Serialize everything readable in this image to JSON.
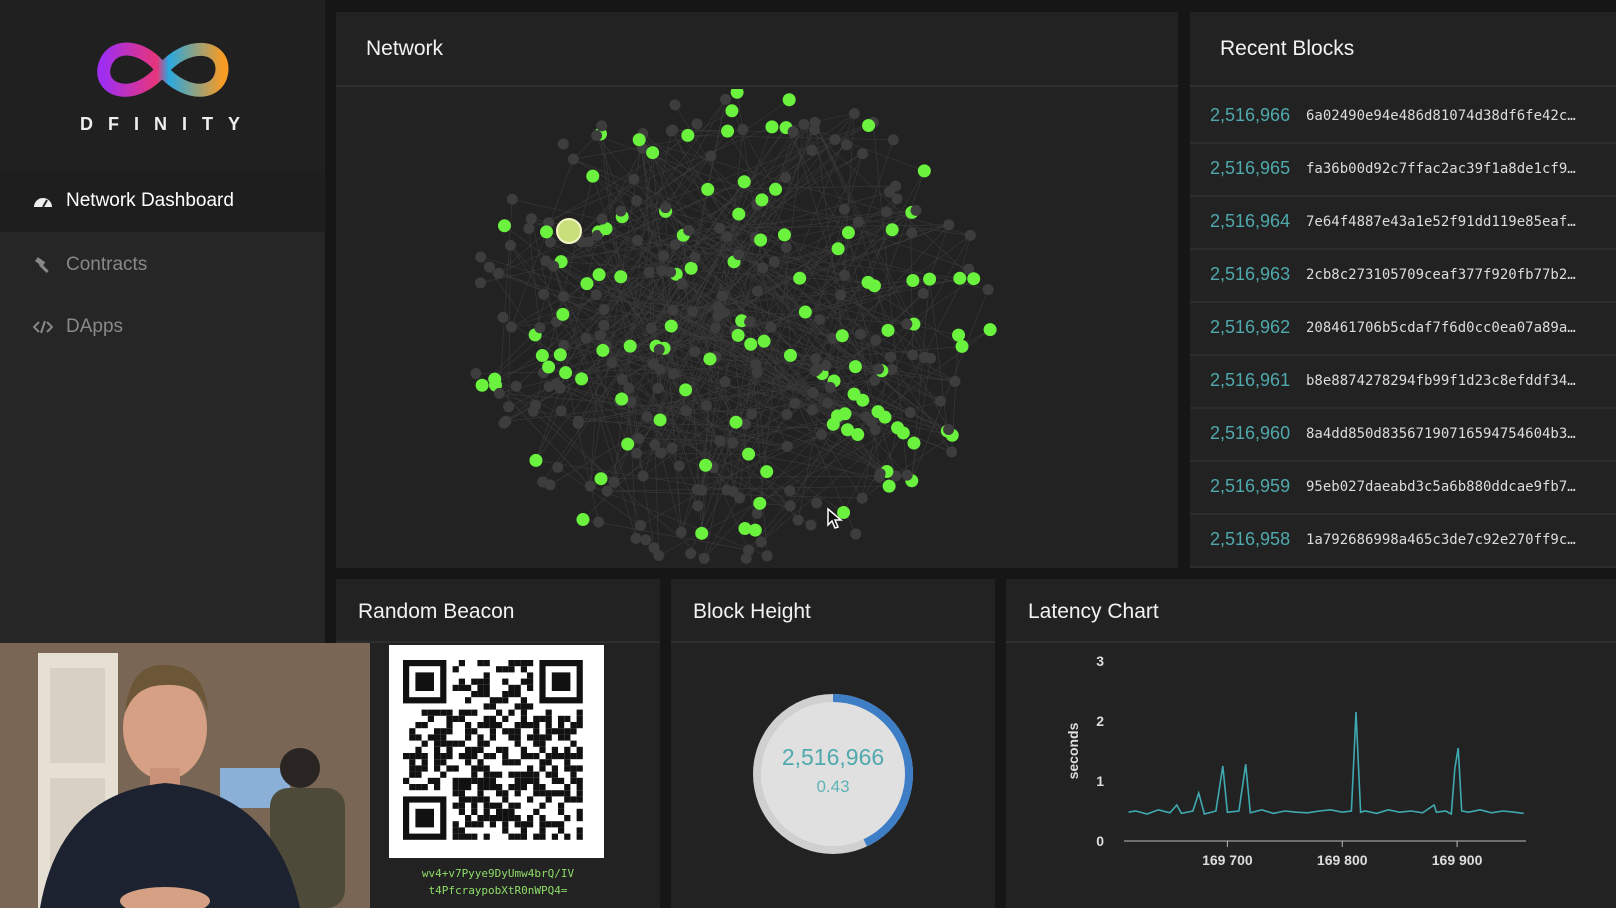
{
  "brand": {
    "logo_text": "DFINITY"
  },
  "sidebar": {
    "items": [
      {
        "label": "Network Dashboard",
        "icon": "dashboard-gauge-icon",
        "active": true
      },
      {
        "label": "Contracts",
        "icon": "hammer-icon",
        "active": false
      },
      {
        "label": "DApps",
        "icon": "code-brackets-icon",
        "active": false
      }
    ]
  },
  "network": {
    "title": "Network",
    "accent": "#6af23f"
  },
  "recent_blocks": {
    "title": "Recent Blocks",
    "rows": [
      {
        "height": "2,516,966",
        "hash": "6a02490e94e486d81074d38df6fe42c…"
      },
      {
        "height": "2,516,965",
        "hash": "fa36b00d92c7ffac2ac39f1a8de1cf9…"
      },
      {
        "height": "2,516,964",
        "hash": "7e64f4887e43a1e52f91dd119e85eaf…"
      },
      {
        "height": "2,516,963",
        "hash": "2cb8c273105709ceaf377f920fb77b2…"
      },
      {
        "height": "2,516,962",
        "hash": "208461706b5cdaf7f6d0cc0ea07a89a…"
      },
      {
        "height": "2,516,961",
        "hash": "b8e8874278294fb99f1d23c8efddf34…"
      },
      {
        "height": "2,516,960",
        "hash": "8a4dd850d83567190716594754604b3…"
      },
      {
        "height": "2,516,959",
        "hash": "95eb027daeabd3c5a6b880ddcae9fb7…"
      },
      {
        "height": "2,516,958",
        "hash": "1a792686998a465c3de7c92e270ff9c…"
      }
    ]
  },
  "random_beacon": {
    "title": "Random Beacon",
    "caption_line1": "wv4+v7Pyye9DyUmw4brQ/IV",
    "caption_line2": "t4PfcraypobXtR0nWPQ4="
  },
  "block_height": {
    "title": "Block Height",
    "value": "2,516,966",
    "sub_value": "0.43",
    "ring_progress": 0.43,
    "accent": "#4fa9ad"
  },
  "latency_chart": {
    "title": "Latency Chart"
  },
  "chart_data": {
    "type": "line",
    "title": "Latency Chart",
    "xlabel": "",
    "ylabel": "seconds",
    "xlim": [
      169610,
      169960
    ],
    "ylim": [
      0,
      3
    ],
    "yticks": [
      "0",
      "1",
      "2",
      "3"
    ],
    "xticks": [
      "169 700",
      "169 800",
      "169 900"
    ],
    "xtick_values": [
      169700,
      169800,
      169900
    ],
    "grid": false,
    "series": [
      {
        "color": "#3fa9b0",
        "x": [
          169614,
          169620,
          169630,
          169640,
          169650,
          169656,
          169660,
          169670,
          169675,
          169680,
          169690,
          169696,
          169700,
          169710,
          169716,
          169720,
          169730,
          169740,
          169750,
          169760,
          169770,
          169780,
          169790,
          169800,
          169808,
          169812,
          169816,
          169820,
          169830,
          169840,
          169850,
          169860,
          169870,
          169880,
          169882,
          169890,
          169895,
          169898,
          169901,
          169904,
          169910,
          169920,
          169930,
          169940,
          169950,
          169958
        ],
        "y": [
          0.48,
          0.5,
          0.45,
          0.52,
          0.47,
          0.6,
          0.46,
          0.5,
          0.8,
          0.45,
          0.5,
          1.25,
          0.48,
          0.5,
          1.28,
          0.47,
          0.52,
          0.46,
          0.5,
          0.48,
          0.47,
          0.5,
          0.52,
          0.48,
          0.5,
          2.15,
          0.48,
          0.5,
          0.46,
          0.52,
          0.48,
          0.5,
          0.47,
          0.6,
          0.48,
          0.5,
          0.45,
          1.2,
          1.55,
          0.5,
          0.48,
          0.52,
          0.47,
          0.5,
          0.48,
          0.46
        ]
      }
    ]
  }
}
